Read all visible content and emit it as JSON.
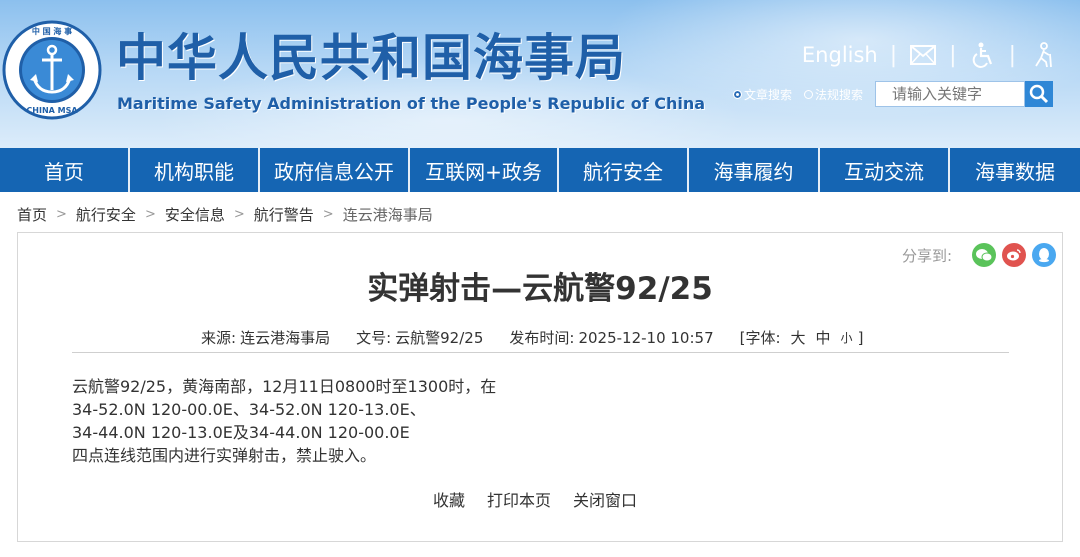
{
  "header": {
    "logo_text": "中国海事 CHINA MSA",
    "title_cn": "中华人民共和国海事局",
    "title_en": "Maritime Safety Administration of the People's Republic of China",
    "english_link": "English",
    "separator": "|",
    "icons": [
      "mail-icon",
      "accessibility-icon",
      "elder-care-icon"
    ],
    "search": {
      "options": [
        "文章搜索",
        "法规搜索"
      ],
      "selected": "文章搜索",
      "placeholder": "请输入关键字"
    }
  },
  "nav": {
    "items": [
      "首页",
      "机构职能",
      "政府信息公开",
      "互联网+政务",
      "航行安全",
      "海事履约",
      "互动交流",
      "海事数据"
    ]
  },
  "breadcrumb": {
    "items": [
      "首页",
      "航行安全",
      "安全信息",
      "航行警告",
      "连云港海事局"
    ],
    "separator": ">"
  },
  "article": {
    "share_label": "分享到:",
    "share_icons": [
      "wechat-icon",
      "weibo-icon",
      "qq-icon"
    ],
    "title": "实弹射击—云航警92/25",
    "meta": {
      "source_label": "来源:",
      "source": "连云港海事局",
      "doc_label": "文号:",
      "doc_no": "云航警92/25",
      "date_label": "发布时间:",
      "date": "2025-12-10 10:57",
      "font_label": "[字体:",
      "font_large": "大",
      "font_medium": "中",
      "font_small": "小",
      "font_close": "]"
    },
    "body": [
      "云航警92/25，黄海南部，12月11日0800时至1300时，在",
      "34-52.0N 120-00.0E、34-52.0N 120-13.0E、",
      "34-44.0N 120-13.0E及34-44.0N 120-00.0E",
      "四点连线范围内进行实弹射击，禁止驶入。"
    ],
    "actions": [
      "收藏",
      "打印本页",
      "关闭窗口"
    ]
  },
  "colors": {
    "nav_bg": "#1565b3",
    "title_blue": "#1f5fa8",
    "search_btn": "#2f87d6",
    "wechat": "#5ac35a",
    "weibo": "#e0534f",
    "qq": "#4aa8f0"
  }
}
